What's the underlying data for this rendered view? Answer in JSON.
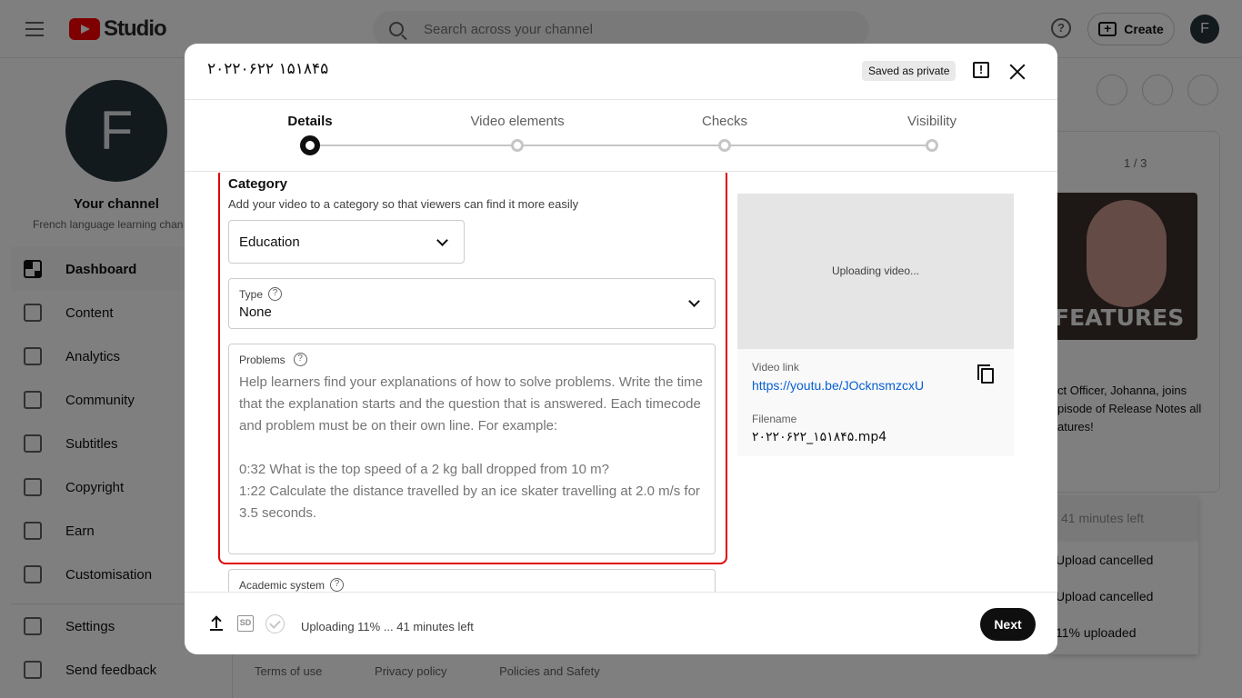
{
  "app": {
    "logo_text": "Studio"
  },
  "topbar": {
    "search_placeholder": "Search across your channel",
    "help": "?",
    "create_label": "Create",
    "avatar_letter": "F"
  },
  "sidebar": {
    "avatar_letter": "F",
    "channel_title": "Your channel",
    "channel_subtitle": "French language learning chan",
    "items": [
      {
        "label": "Dashboard",
        "icon": "dashboard-icon",
        "active": true
      },
      {
        "label": "Content",
        "icon": "content-icon"
      },
      {
        "label": "Analytics",
        "icon": "analytics-icon"
      },
      {
        "label": "Community",
        "icon": "community-icon"
      },
      {
        "label": "Subtitles",
        "icon": "subtitles-icon"
      },
      {
        "label": "Copyright",
        "icon": "copyright-icon"
      },
      {
        "label": "Earn",
        "icon": "dollar-icon"
      },
      {
        "label": "Customisation",
        "icon": "magic-wand-icon"
      }
    ],
    "bottom_items": [
      {
        "label": "Settings",
        "icon": "gear-icon"
      },
      {
        "label": "Send feedback",
        "icon": "feedback-icon"
      }
    ]
  },
  "background": {
    "pager": "1 / 3",
    "thumb_text": "FEATURES",
    "news_text": "ct Officer, Johanna, joins pisode of Release Notes all atures!",
    "upload_panel": {
      "head": "41 minutes left",
      "rows": [
        "Upload cancelled",
        "Upload cancelled",
        "11% uploaded"
      ]
    },
    "footer_links": [
      "Terms of use",
      "Privacy policy",
      "Policies and Safety"
    ]
  },
  "modal": {
    "title": "۲۰۲۲۰۶۲۲ ۱۵۱۸۴۵",
    "saved_badge": "Saved as private",
    "steps": [
      {
        "label": "Details",
        "active": true
      },
      {
        "label": "Video elements"
      },
      {
        "label": "Checks"
      },
      {
        "label": "Visibility"
      }
    ],
    "category": {
      "heading": "Category",
      "description": "Add your video to a category so that viewers can find it more easily",
      "selected": "Education"
    },
    "type": {
      "label": "Type",
      "value": "None"
    },
    "problems": {
      "label": "Problems",
      "placeholder": "Help learners find your explanations of how to solve problems. Write the time that the explanation starts and the question that is answered. Each timecode and problem must be on their own line. For example:\n\n0:32 What is the top speed of a 2 kg ball dropped from 10 m?\n1:22 Calculate the distance travelled by an ice skater travelling at 2.0 m/s for 3.5 seconds."
    },
    "academic": {
      "label": "Academic system"
    },
    "preview": {
      "status": "Uploading video...",
      "link_label": "Video link",
      "link": "https://youtu.be/JOcknsmzcxU",
      "filename_label": "Filename",
      "filename": "۲۰۲۲۰۶۲۲_۱۵۱۸۴۵.mp4"
    },
    "footer": {
      "sd_badge": "SD",
      "status": "Uploading 11% ... 41 minutes left",
      "next_label": "Next"
    }
  }
}
